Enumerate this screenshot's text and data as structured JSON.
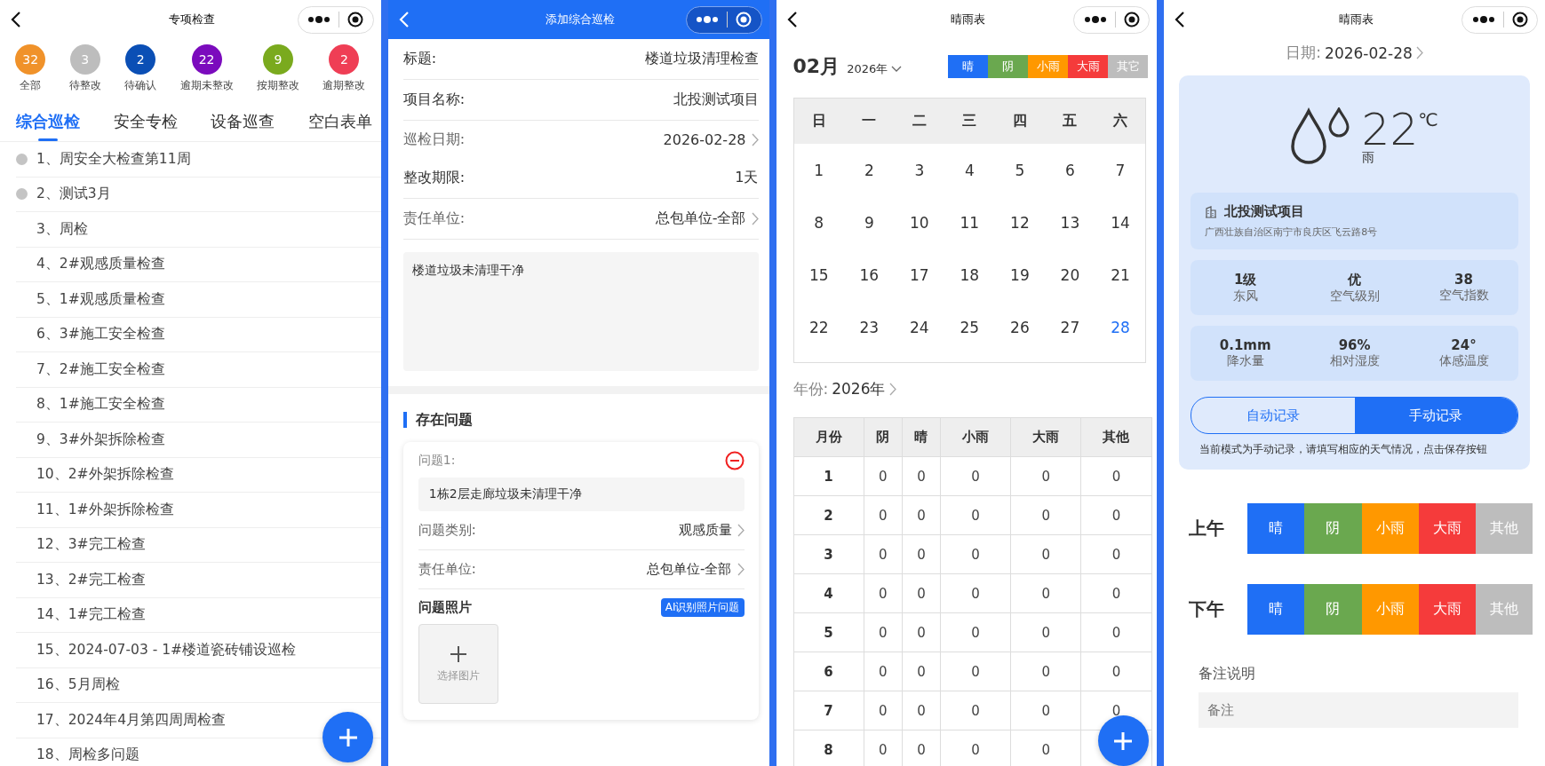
{
  "inspection_list": {
    "nav": {
      "title": "专项检查",
      "kind": "plain"
    },
    "status_counts": [
      {
        "count": "32",
        "label": "全部",
        "color": "#f0922a"
      },
      {
        "count": "3",
        "label": "待整改",
        "color": "#bdbdbd"
      },
      {
        "count": "2",
        "label": "待确认",
        "color": "#0b4fb5"
      },
      {
        "count": "22",
        "label": "逾期未整改",
        "color": "#7b0bbd"
      },
      {
        "count": "9",
        "label": "按期整改",
        "color": "#7aaa1e"
      },
      {
        "count": "2",
        "label": "逾期整改",
        "color": "#ef3e55"
      }
    ],
    "tabs": [
      {
        "label": "综合巡检",
        "selected": true
      },
      {
        "label": "安全专检",
        "selected": false
      },
      {
        "label": "设备巡查",
        "selected": false
      },
      {
        "label": "空白表单",
        "selected": false
      }
    ],
    "items": [
      {
        "text": "1、周安全大检查第11周",
        "dot": true
      },
      {
        "text": "2、测试3月",
        "dot": true
      },
      {
        "text": "3、周检",
        "dot": false
      },
      {
        "text": "4、2#观感质量检查",
        "dot": false
      },
      {
        "text": "5、1#观感质量检查",
        "dot": false
      },
      {
        "text": "6、3#施工安全检查",
        "dot": false
      },
      {
        "text": "7、2#施工安全检查",
        "dot": false
      },
      {
        "text": "8、1#施工安全检查",
        "dot": false
      },
      {
        "text": "9、3#外架拆除检查",
        "dot": false
      },
      {
        "text": "10、2#外架拆除检查",
        "dot": false
      },
      {
        "text": "11、1#外架拆除检查",
        "dot": false
      },
      {
        "text": "12、3#完工检查",
        "dot": false
      },
      {
        "text": "13、2#完工检查",
        "dot": false
      },
      {
        "text": "14、1#完工检查",
        "dot": false
      },
      {
        "text": "15、2024-07-03 - 1#楼道瓷砖铺设巡检",
        "dot": false
      },
      {
        "text": "16、5月周检",
        "dot": false
      },
      {
        "text": "17、2024年4月第四周周检查",
        "dot": false
      },
      {
        "text": "18、周检多问题",
        "dot": false
      }
    ]
  },
  "add_inspection": {
    "nav": {
      "title": "添加综合巡检",
      "kind": "blue"
    },
    "fields": [
      {
        "label": "标题:",
        "value": "楼道垃圾清理检查",
        "kind": "static"
      },
      {
        "label": "项目名称:",
        "value": "北投测试项目",
        "kind": "static"
      },
      {
        "label": "巡检日期:",
        "value": "2026-02-28",
        "kind": "picker"
      },
      {
        "label": "整改期限:",
        "value": "1天",
        "kind": "static"
      },
      {
        "label": "责任单位:",
        "value": "总包单位-全部",
        "kind": "picker"
      }
    ],
    "description": "楼道垃圾未清理干净",
    "section_title": "存在问题",
    "issue": {
      "label": "问题1:",
      "text": "1栋2层走廊垃圾未清理干净",
      "fields": [
        {
          "label": "问题类别:",
          "value": "观感质量"
        },
        {
          "label": "责任单位:",
          "value": "总包单位-全部"
        }
      ],
      "photos_label": "问题照片",
      "ai_button": "AI识别照片问题",
      "upload_label": "选择图片"
    }
  },
  "weather_calendar": {
    "nav": {
      "title": "晴雨表",
      "kind": "plain"
    },
    "month": "02月",
    "year": "2026年",
    "legend": [
      {
        "label": "晴",
        "color": "#1f6ff5"
      },
      {
        "label": "阴",
        "color": "#6aa84f"
      },
      {
        "label": "小雨",
        "color": "#ff9800"
      },
      {
        "label": "大雨",
        "color": "#f53b3b"
      },
      {
        "label": "其它",
        "color": "#bdbdbd"
      }
    ],
    "weekdays": [
      "日",
      "一",
      "二",
      "三",
      "四",
      "五",
      "六"
    ],
    "days": [
      {
        "text": "1",
        "selected": false
      },
      {
        "text": "2",
        "selected": false
      },
      {
        "text": "3",
        "selected": false
      },
      {
        "text": "4",
        "selected": false
      },
      {
        "text": "5",
        "selected": false
      },
      {
        "text": "6",
        "selected": false
      },
      {
        "text": "7",
        "selected": false
      },
      {
        "text": "8",
        "selected": false
      },
      {
        "text": "9",
        "selected": false
      },
      {
        "text": "10",
        "selected": false
      },
      {
        "text": "11",
        "selected": false
      },
      {
        "text": "12",
        "selected": false
      },
      {
        "text": "13",
        "selected": false
      },
      {
        "text": "14",
        "selected": false
      },
      {
        "text": "15",
        "selected": false
      },
      {
        "text": "16",
        "selected": false
      },
      {
        "text": "17",
        "selected": false
      },
      {
        "text": "18",
        "selected": false
      },
      {
        "text": "19",
        "selected": false
      },
      {
        "text": "20",
        "selected": false
      },
      {
        "text": "21",
        "selected": false
      },
      {
        "text": "22",
        "selected": false
      },
      {
        "text": "23",
        "selected": false
      },
      {
        "text": "24",
        "selected": false
      },
      {
        "text": "25",
        "selected": false
      },
      {
        "text": "26",
        "selected": false
      },
      {
        "text": "27",
        "selected": false
      },
      {
        "text": "28",
        "selected": true
      }
    ],
    "year_label": "年份:",
    "year_value": "2026年",
    "table": {
      "columns": [
        "月份",
        "阴",
        "晴",
        "小雨",
        "大雨",
        "其他"
      ],
      "rows": [
        [
          "1",
          "0",
          "0",
          "0",
          "0",
          "0"
        ],
        [
          "2",
          "0",
          "0",
          "0",
          "0",
          "0"
        ],
        [
          "3",
          "0",
          "0",
          "0",
          "0",
          "0"
        ],
        [
          "4",
          "0",
          "0",
          "0",
          "0",
          "0"
        ],
        [
          "5",
          "0",
          "0",
          "0",
          "0",
          "0"
        ],
        [
          "6",
          "0",
          "0",
          "0",
          "0",
          "0"
        ],
        [
          "7",
          "0",
          "0",
          "0",
          "0",
          "0"
        ],
        [
          "8",
          "0",
          "0",
          "0",
          "0"
        ]
      ]
    }
  },
  "weather_entry": {
    "nav": {
      "title": "晴雨表",
      "kind": "plain"
    },
    "date_label": "日期:",
    "date_value": "2026-02-28",
    "temperature": "22",
    "unit": "℃",
    "condition": "雨",
    "project": {
      "name": "北投测试项目",
      "address": "广西壮族自治区南宁市良庆区飞云路8号"
    },
    "stat_groups": [
      [
        {
          "value": "1级",
          "label": "东风"
        },
        {
          "value": "优",
          "label": "空气级别"
        },
        {
          "value": "38",
          "label": "空气指数"
        }
      ],
      [
        {
          "value": "0.1mm",
          "label": "降水量"
        },
        {
          "value": "96%",
          "label": "相对湿度"
        },
        {
          "value": "24°",
          "label": "体感温度"
        }
      ]
    ],
    "modes": [
      {
        "label": "自动记录",
        "selected": false
      },
      {
        "label": "手动记录",
        "selected": true
      }
    ],
    "mode_note": "当前模式为手动记录，请填写相应的天气情况，点击保存按钮",
    "periods": [
      {
        "label": "上午",
        "options": [
          {
            "label": "晴",
            "color": "#1f6ff5"
          },
          {
            "label": "阴",
            "color": "#6aa84f"
          },
          {
            "label": "小雨",
            "color": "#ff9800"
          },
          {
            "label": "大雨",
            "color": "#f53b3b"
          },
          {
            "label": "其他",
            "color": "#bdbdbd"
          }
        ]
      },
      {
        "label": "下午",
        "options": [
          {
            "label": "晴",
            "color": "#1f6ff5"
          },
          {
            "label": "阴",
            "color": "#6aa84f"
          },
          {
            "label": "小雨",
            "color": "#ff9800"
          },
          {
            "label": "大雨",
            "color": "#f53b3b"
          },
          {
            "label": "其他",
            "color": "#bdbdbd"
          }
        ]
      }
    ],
    "remark_label": "备注说明",
    "remark_placeholder": "备注"
  }
}
